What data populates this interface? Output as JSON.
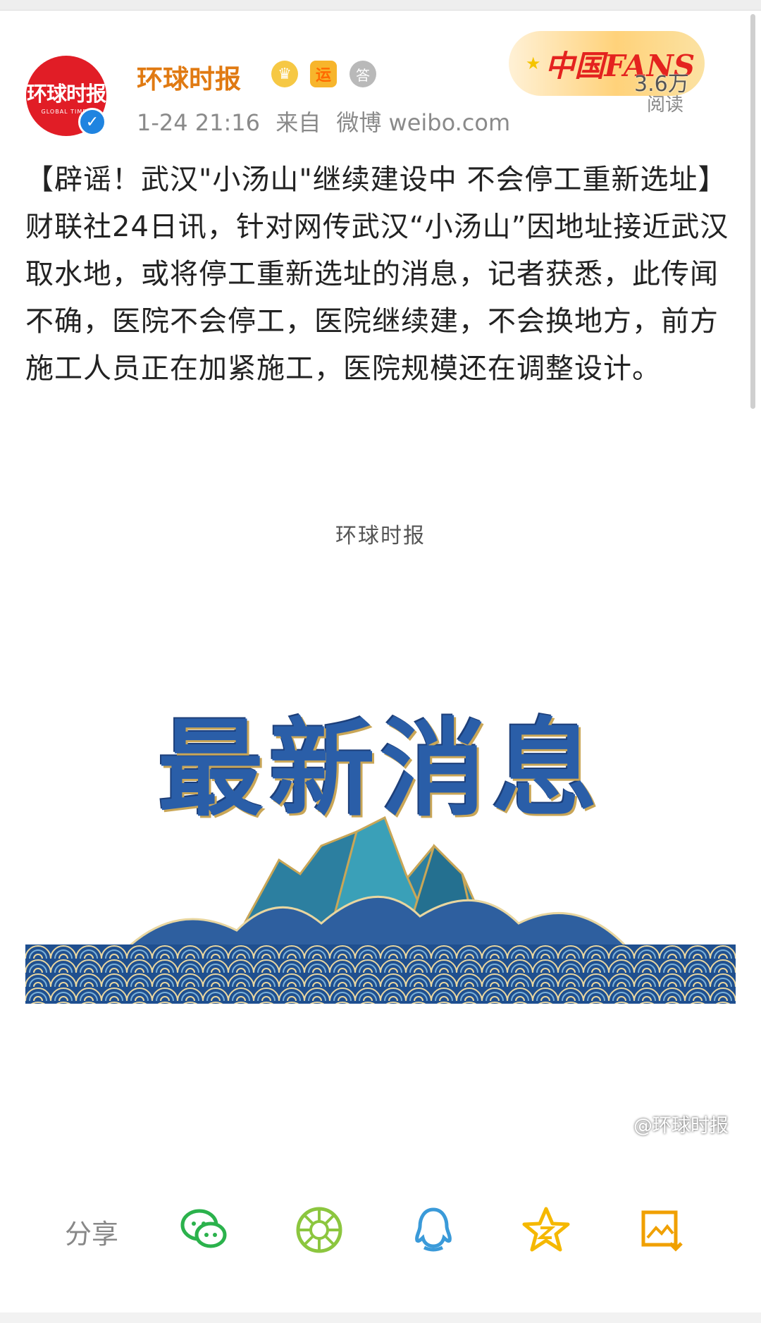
{
  "author": {
    "avatar_logo": "环球时报",
    "avatar_sub": "GLOBAL TIMES",
    "name": "环球时报",
    "verified_icon": "verified-check-icon",
    "badges": [
      "crown-icon",
      "运",
      "答"
    ]
  },
  "meta": {
    "time": "1-24 21:16",
    "source_prefix": "来自",
    "source": "微博 weibo.com"
  },
  "fans_badge": {
    "text": "中国FANS",
    "read_count": "3.6万",
    "read_label": "阅读"
  },
  "post": {
    "text": "【辟谣！武汉\"小汤山\"继续建设中 不会停工重新选址】财联社24日讯，针对网传武汉“小汤山”因地址接近武汉取水地，或将停工重新选址的消息，记者获悉，此传闻不确，医院不会停工，医院继续建，不会换地方，前方施工人员正在加紧施工，医院规模还在调整设计。"
  },
  "image": {
    "logo_text": "环球时报",
    "headline": "最新消息",
    "watermark": "@环球时报"
  },
  "share": {
    "label": "分享",
    "targets": [
      "wechat-icon",
      "moments-icon",
      "qq-icon",
      "qzone-icon",
      "save-image-icon"
    ]
  },
  "colors": {
    "brand_red": "#e11d26",
    "name_orange": "#e07a12",
    "wechat_green": "#2bb24c",
    "moments_green": "#8cc63f",
    "qq_blue": "#3a9ad9",
    "qzone_yellow": "#f5b800",
    "save_orange": "#f0a000"
  }
}
